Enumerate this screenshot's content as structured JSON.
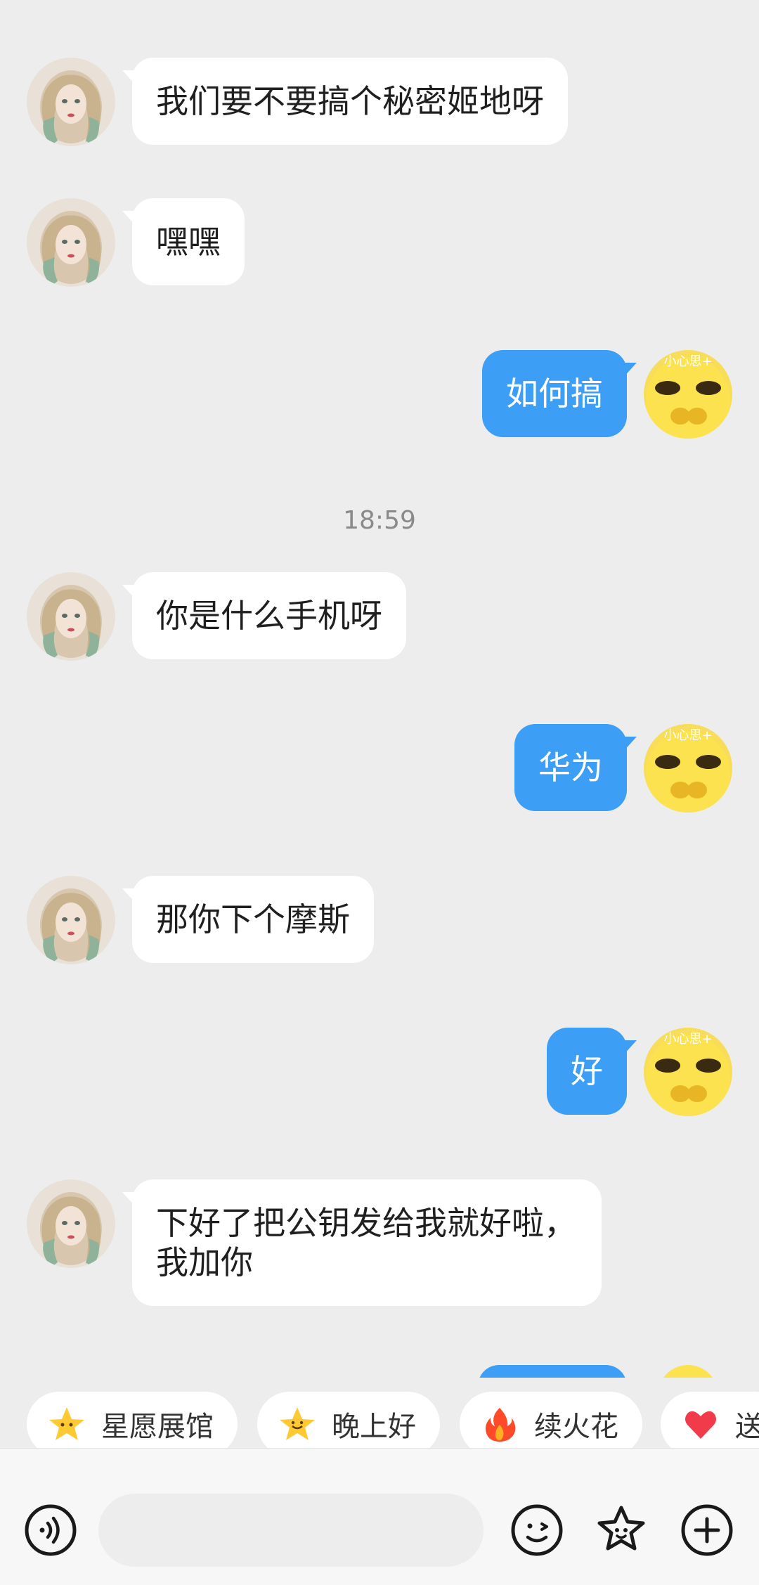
{
  "messages": [
    {
      "side": "left",
      "text": "我们要不要搞个秘密姬地呀"
    },
    {
      "side": "left",
      "text": "嘿嘿"
    },
    {
      "side": "right",
      "text": "如何搞"
    },
    {
      "side": "left",
      "text": "你是什么手机呀"
    },
    {
      "side": "right",
      "text": "华为"
    },
    {
      "side": "left",
      "text": "那你下个摩斯"
    },
    {
      "side": "right",
      "text": "好"
    },
    {
      "side": "left",
      "text": "下好了把公钥发给我就好啦，我加你"
    }
  ],
  "timestamp": "18:59",
  "self_avatar_caption": "小心思+",
  "quick_replies": [
    {
      "label": "星愿展馆",
      "icon": "star-face-icon"
    },
    {
      "label": "晚上好",
      "icon": "smiling-star-icon"
    },
    {
      "label": "续火花",
      "icon": "fire-icon"
    },
    {
      "label": "送",
      "icon": "heart-icon"
    }
  ],
  "input": {
    "placeholder": ""
  },
  "colors": {
    "background": "#ededed",
    "self_bubble": "#3d9ef5",
    "other_bubble": "#ffffff"
  }
}
